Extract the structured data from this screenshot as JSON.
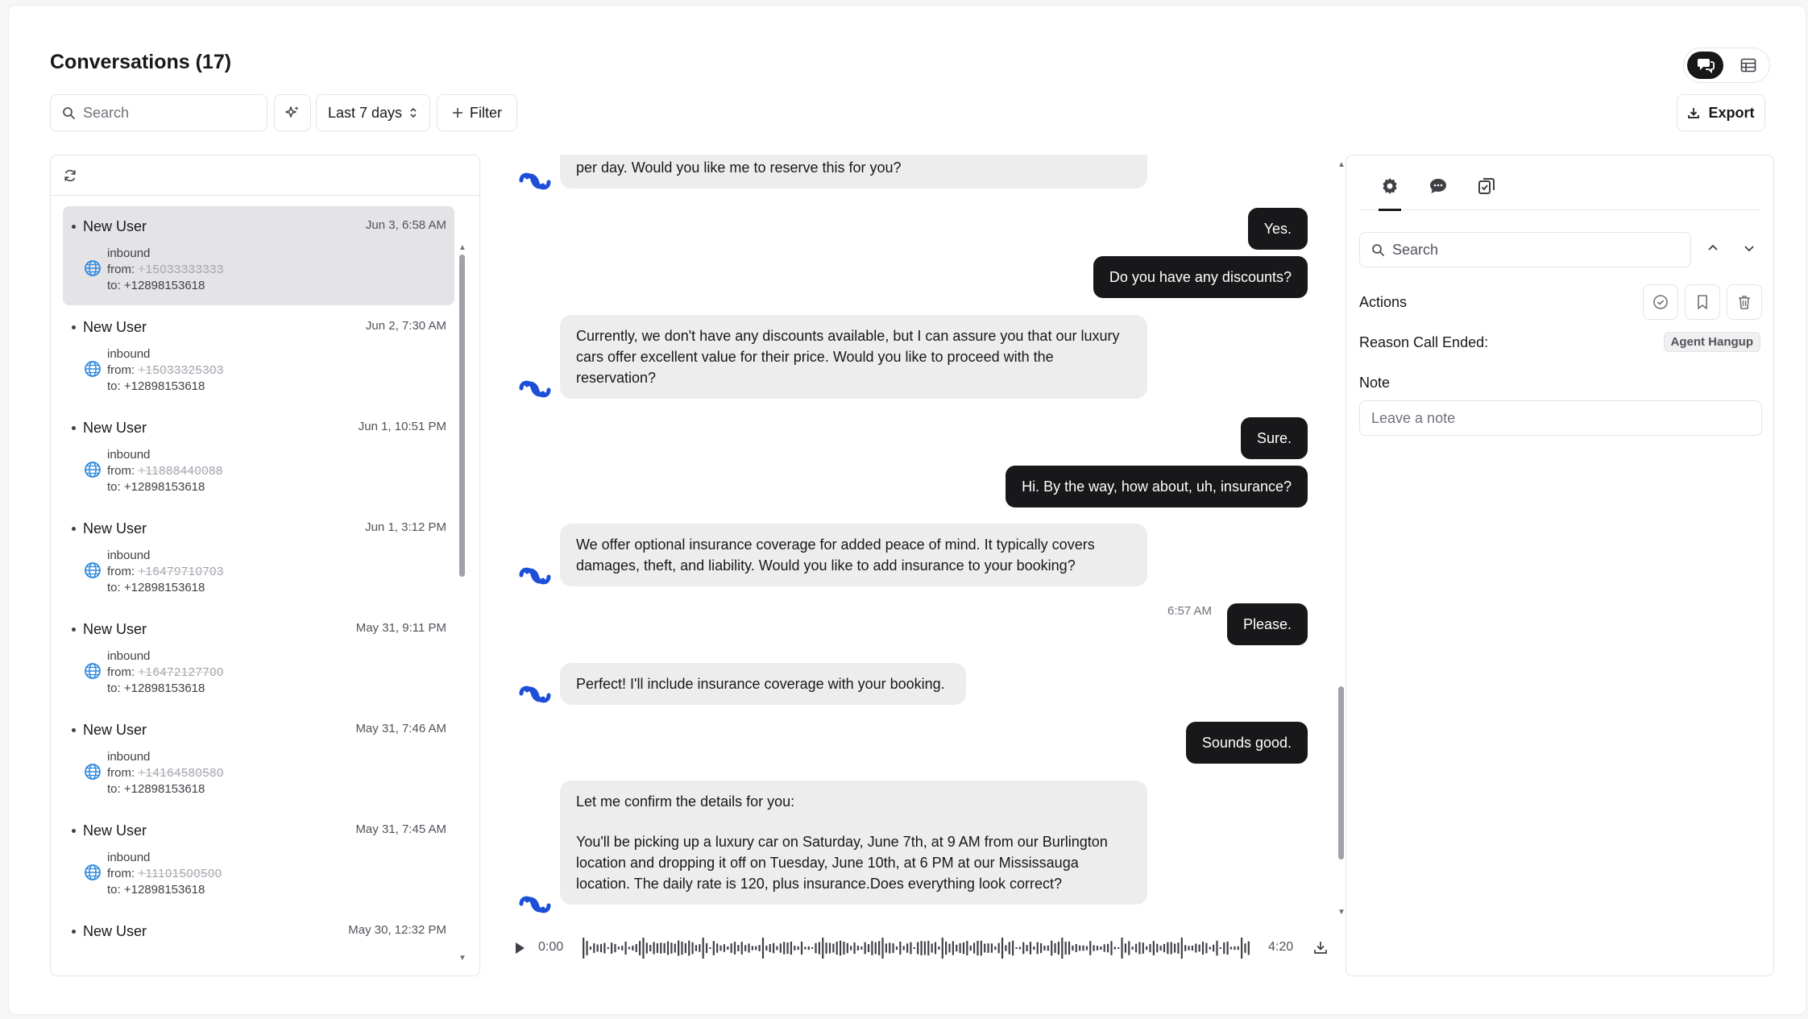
{
  "page": {
    "title": "Conversations (17)"
  },
  "toolbar": {
    "search_placeholder": "Search",
    "date_range": "Last 7 days",
    "filter_label": "Filter",
    "export_label": "Export"
  },
  "conversations": [
    {
      "name": "New User",
      "date": "Jun 3, 6:58 AM",
      "direction": "inbound",
      "from_label": "from:",
      "from_number": "+15033333333",
      "to": "to: +12898153618",
      "selected": true
    },
    {
      "name": "New User",
      "date": "Jun 2, 7:30 AM",
      "direction": "inbound",
      "from_label": "from:",
      "from_number": "+15033325303",
      "to": "to: +12898153618",
      "selected": false
    },
    {
      "name": "New User",
      "date": "Jun 1, 10:51 PM",
      "direction": "inbound",
      "from_label": "from:",
      "from_number": "+11888440088",
      "to": "to: +12898153618",
      "selected": false
    },
    {
      "name": "New User",
      "date": "Jun 1, 3:12 PM",
      "direction": "inbound",
      "from_label": "from:",
      "from_number": "+16479710703",
      "to": "to: +12898153618",
      "selected": false
    },
    {
      "name": "New User",
      "date": "May 31, 9:11 PM",
      "direction": "inbound",
      "from_label": "from:",
      "from_number": "+16472127700",
      "to": "to: +12898153618",
      "selected": false
    },
    {
      "name": "New User",
      "date": "May 31, 7:46 AM",
      "direction": "inbound",
      "from_label": "from:",
      "from_number": "+14164580580",
      "to": "to: +12898153618",
      "selected": false
    },
    {
      "name": "New User",
      "date": "May 31, 7:45 AM",
      "direction": "inbound",
      "from_label": "from:",
      "from_number": "+11101500500",
      "to": "to: +12898153618",
      "selected": false
    },
    {
      "name": "New User",
      "date": "May 30, 12:32 PM",
      "direction": "",
      "from_label": "",
      "from_number": "",
      "to": "",
      "selected": false
    }
  ],
  "transcript": {
    "messages": [
      {
        "role": "agent",
        "text": "per day. Would you like me to reserve this for you?"
      },
      {
        "role": "user",
        "text": "Yes."
      },
      {
        "role": "user",
        "text": "Do you have any discounts?"
      },
      {
        "role": "agent",
        "text": "Currently, we don't have any discounts available, but I can assure you that our luxury cars offer excellent value for their price. Would you like to proceed with the reservation?"
      },
      {
        "role": "user",
        "text": "Sure."
      },
      {
        "role": "user",
        "text": "Hi. By the way, how about, uh, insurance?"
      },
      {
        "role": "agent",
        "text": "We offer optional insurance coverage for added peace of mind. It typically covers damages, theft, and liability. Would you like to add insurance to your booking?"
      },
      {
        "role": "user",
        "text": "Please.",
        "time": "6:57 AM"
      },
      {
        "role": "agent",
        "text": "Perfect! I'll include insurance coverage with your booking."
      },
      {
        "role": "user",
        "text": "Sounds good."
      },
      {
        "role": "agent",
        "text": "Let me confirm the details for you:"
      },
      {
        "role": "agent_cont",
        "text": "You'll be picking up a luxury car on Saturday, June 7th, at 9 AM from our Burlington location and dropping it off on Tuesday, June 10th, at 6 PM at our Mississauga location. The daily rate is 120, plus insurance.Does everything look correct?"
      }
    ]
  },
  "audio": {
    "current_time": "0:00",
    "duration": "4:20",
    "progress": 0.0
  },
  "side_panel": {
    "search_placeholder": "Search",
    "actions_label": "Actions",
    "reason_label": "Reason Call Ended:",
    "reason_value": "Agent Hangup",
    "note_label": "Note",
    "note_placeholder": "Leave a note"
  },
  "icons": {
    "search": "search-icon",
    "sparkle": "sparkle-icon",
    "chevron_updown": "chevron-updown-icon",
    "plus": "plus-icon",
    "download": "download-icon",
    "refresh": "refresh-icon",
    "globe": "globe-icon",
    "agent_logo": "agent-logo-icon",
    "play": "play-icon",
    "gear": "gear-icon",
    "chat": "chat-icon",
    "checklist": "checklist-icon",
    "check_circle": "check-circle-icon",
    "bookmark": "bookmark-icon",
    "trash": "trash-icon",
    "chat_view": "chat-view-icon",
    "table_view": "table-view-icon"
  },
  "colors": {
    "accent": "#18181b",
    "agent_logo": "#1d4ed8",
    "globe": "#2f8ae0",
    "agent_bubble": "#ededee",
    "user_bubble": "#18181b"
  }
}
